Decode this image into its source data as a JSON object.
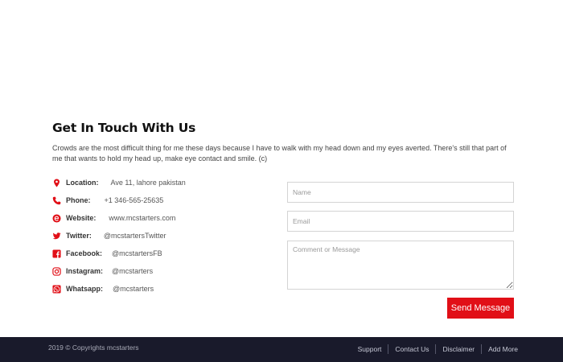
{
  "contact": {
    "title": "Get In Touch With Us",
    "description": "Crowds are the most difficult thing for me these days because I have to walk with my head down and my eyes averted. There's still that part of me that wants to hold my head up, make eye contact and smile. (c)",
    "items": [
      {
        "icon": "location-pin-icon",
        "label": "Location:",
        "value": "Ave 11, lahore pakistan"
      },
      {
        "icon": "phone-icon",
        "label": "Phone:",
        "value": "+1 346-565-25635"
      },
      {
        "icon": "website-icon",
        "label": "Website:",
        "value": "www.mcstarters.com"
      },
      {
        "icon": "twitter-icon",
        "label": "Twitter:",
        "value": "@mcstartersTwitter"
      },
      {
        "icon": "facebook-icon",
        "label": "Facebook:",
        "value": "@mcstartersFB"
      },
      {
        "icon": "instagram-icon",
        "label": "Instagram:",
        "value": "@mcstarters"
      },
      {
        "icon": "whatsapp-icon",
        "label": "Whatsapp:",
        "value": "@mcstarters"
      }
    ]
  },
  "form": {
    "name_placeholder": "Name",
    "email_placeholder": "Email",
    "message_placeholder": "Comment or Message",
    "send_label": "Send Message"
  },
  "footer": {
    "copyright": "2019 © Copyrights mcstarters",
    "links": [
      "Support",
      "Contact Us",
      "Disclaimer",
      "Add More"
    ]
  },
  "colors": {
    "accent": "#e10f17",
    "footer_bg": "#191a2b"
  }
}
